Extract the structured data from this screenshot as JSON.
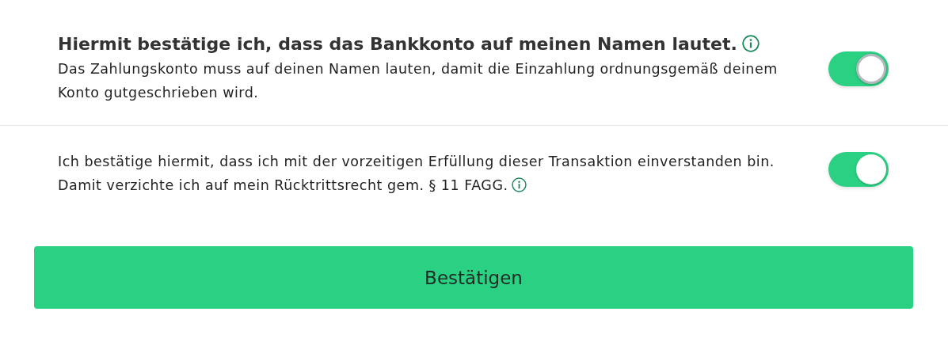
{
  "consents": [
    {
      "title": "Hiermit bestätige ich, dass das Bankkonto auf meinen Namen lautet.",
      "title_info": true,
      "text": [
        "Das Zahlungskonto muss auf deinen Namen lauten, damit die Einzahlung ordnungsgemäß deinem Konto gutgeschrieben wird."
      ],
      "text_info": false,
      "on": true,
      "focused": true
    },
    {
      "text": [
        "Ich bestätige hiermit, dass ich mit der vorzeitigen Erfüllung dieser Transaktion einverstanden bin.",
        "Damit verzichte ich auf mein Rücktrittsrecht gem. § 11 FAGG."
      ],
      "text_info": true,
      "on": true,
      "focused": false
    }
  ],
  "submit": {
    "label": "Bestätigen"
  }
}
